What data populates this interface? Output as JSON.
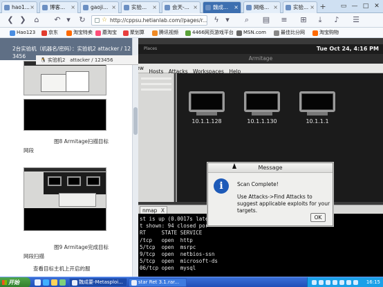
{
  "browser": {
    "tabs": [
      {
        "label": "hao1..."
      },
      {
        "label": "博客..."
      },
      {
        "label": "gaoji..."
      },
      {
        "label": "实验..."
      },
      {
        "label": "会天-..."
      },
      {
        "label": "魏成..."
      },
      {
        "label": "网络..."
      },
      {
        "label": "实验..."
      }
    ],
    "new_tab": "+",
    "url": "http://cppsu.hetianlab.com//pages/r...",
    "window_controls": [
      "▭",
      "—",
      "□",
      "✕"
    ]
  },
  "bookmarks": [
    "Hao123",
    "京东",
    "淘宝特卖",
    "蘑淘宝",
    "聚划算",
    "腾讯视频",
    "4466网页游戏平台",
    "MSN.com",
    "最佳比分网",
    "淘宝购物"
  ],
  "left_panel": {
    "breadcrumb_line1": "2台实验机（机器名/密码）：实验机2  attacker / 12",
    "breadcrumb_line2": "3456",
    "vm_label": "实验机2",
    "vm_credentials": "attacker / 123456",
    "caption1_line1": "图8 Armitage扫描目标",
    "caption1_line2": "网段",
    "caption2_line1": "图9 Armitage完成目标",
    "caption2_line2": "网段扫描",
    "caption3": "查看目标主机上开启的服"
  },
  "vm": {
    "places_label": "Places",
    "clock": "Tue Oct 24,  4:16 PM",
    "window_title": "Armitage",
    "menu": [
      "View",
      "Hosts",
      "Attacks",
      "Workspaces",
      "Help"
    ],
    "hosts": [
      "10.1.1.128",
      "10.1.1.130",
      "10.1.1.1"
    ],
    "console_tab": "nmap",
    "console_tab_close": "X",
    "console_lines": [
      "st is up (0.0017s late",
      "t shown: 94 closed por",
      "RT     STATE SERVICE",
      "/tcp   open  http",
      "5/tcp  open  msrpc",
      "9/tcp  open  netbios-ssn",
      "5/tcp  open  microsoft-ds",
      "06/tcp open  mysql"
    ]
  },
  "dialog": {
    "title": "Message",
    "icon_glyph": "i",
    "line1": "Scan Complete!",
    "line2": "Use Attacks->Find Attacks to suggest applicable exploits for your targets.",
    "ok": "OK"
  },
  "taskbar": {
    "start": "开始",
    "tasks": [
      "魏成要-Metasploi...",
      "star Ret 3.1.rar..."
    ],
    "clock": "16:15"
  }
}
